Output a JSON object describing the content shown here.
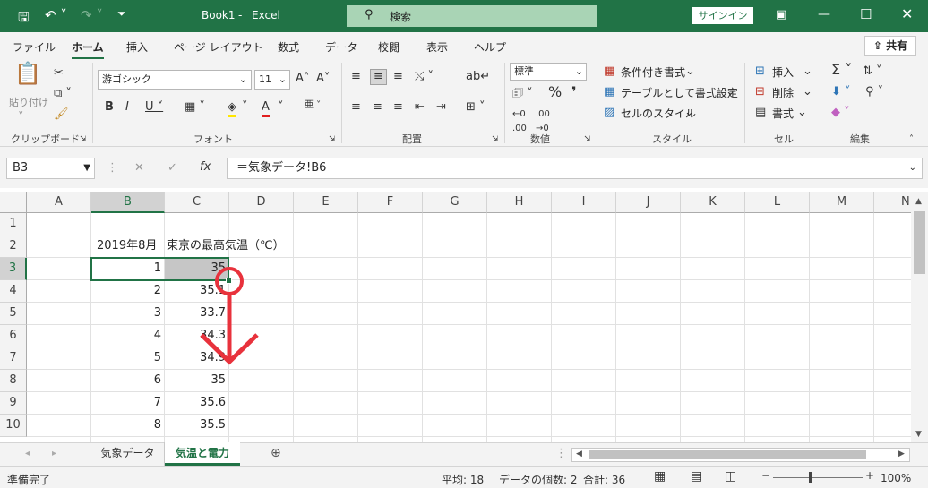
{
  "title_bar": {
    "file_name": "Book1",
    "separator": "-",
    "app_name": "Excel",
    "search_label": "検索",
    "signin_label": "サインイン"
  },
  "menu": {
    "items": [
      "ファイル",
      "ホーム",
      "挿入",
      "ページ レイアウト",
      "数式",
      "データ",
      "校閲",
      "表示",
      "ヘルプ"
    ],
    "active": "ホーム",
    "share_label": "共有"
  },
  "ribbon": {
    "clipboard": {
      "paste_label": "貼り付け",
      "group_label": "クリップボード"
    },
    "font": {
      "font_name": "游ゴシック",
      "font_size": "11",
      "group_label": "フォント"
    },
    "alignment": {
      "group_label": "配置"
    },
    "number": {
      "format_value": "標準",
      "group_label": "数値"
    },
    "styles": {
      "conditional": "条件付き書式",
      "as_table": "テーブルとして書式設定",
      "cell_styles": "セルのスタイル",
      "group_label": "スタイル"
    },
    "cells": {
      "insert": "挿入",
      "delete": "削除",
      "format": "書式",
      "group_label": "セル"
    },
    "editing": {
      "group_label": "編集"
    }
  },
  "formula_bar": {
    "name_box": "B3",
    "fx_label": "fx",
    "formula": "＝気象データ!B6"
  },
  "grid": {
    "columns": [
      "A",
      "B",
      "C",
      "D",
      "E",
      "F",
      "G",
      "H",
      "I",
      "J",
      "K",
      "L",
      "M",
      "N"
    ],
    "rows": [
      "1",
      "2",
      "3",
      "4",
      "5",
      "6",
      "7",
      "8",
      "9",
      "10"
    ],
    "b2_text": "2019年8月",
    "c2_text": "東京の最高気温（℃）",
    "b_values": [
      "1",
      "2",
      "3",
      "4",
      "5",
      "6",
      "7",
      "8"
    ],
    "c_values": [
      "35",
      "35.1",
      "33.7",
      "34.3",
      "34.9",
      "35",
      "35.6",
      "35.5"
    ],
    "selected_cell": "B3",
    "highlighted_cell": "C3",
    "annotation_color": "#e8323c"
  },
  "sheet_tabs": {
    "tabs": [
      "気象データ",
      "気温と電力"
    ],
    "active": "気温と電力"
  },
  "status_bar": {
    "ready": "準備完了",
    "average": "平均: 18",
    "count": "データの個数: 2",
    "sum": "合計: 36",
    "zoom": "100%"
  },
  "colors": {
    "brand": "#217346"
  }
}
